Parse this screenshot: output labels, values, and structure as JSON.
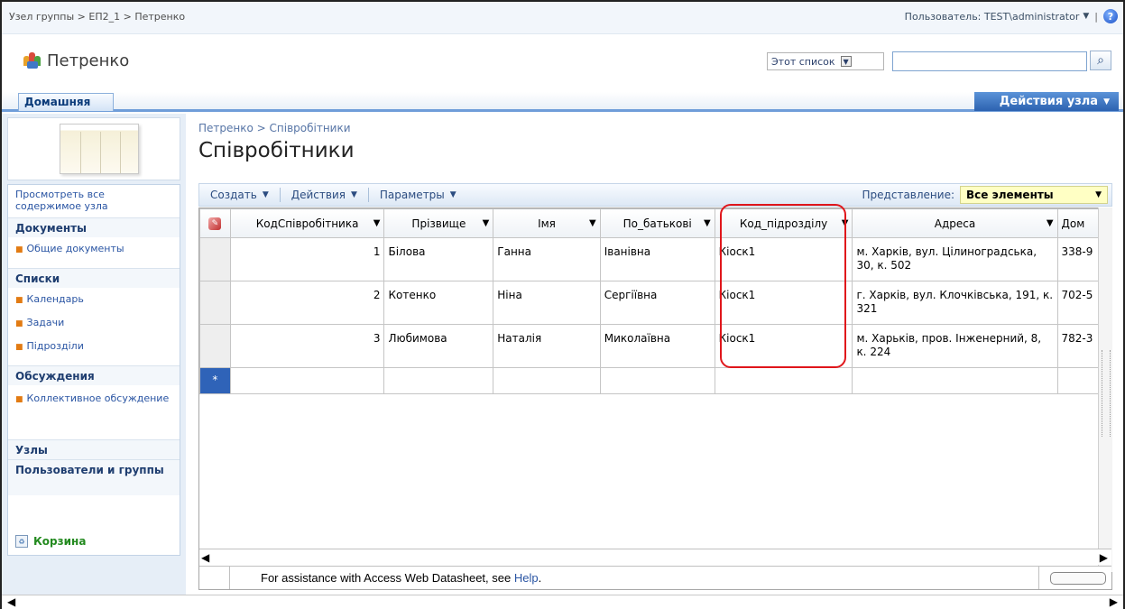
{
  "top": {
    "breadcrumb": "Узел группы > ЕП2_1 > Петренко",
    "user_label": "Пользователь: TEST\\administrator",
    "dropdown_glyph": "▼",
    "separator": "|",
    "help_glyph": "?"
  },
  "site": {
    "title": "Петренко",
    "scope": "Этот список",
    "search_value": "",
    "search_glyph": "⌕"
  },
  "nav": {
    "home_tab": "Домашняя",
    "site_actions": "Действия узла"
  },
  "quicklaunch": {
    "view_all": "Просмотреть все содержимое узла",
    "sections": [
      {
        "title": "Документы",
        "items": [
          "Общие документы"
        ]
      },
      {
        "title": "Списки",
        "items": [
          "Календарь",
          "Задачи",
          "Підрозділи"
        ]
      },
      {
        "title": "Обсуждения",
        "items": [
          "Коллективное обсуждение"
        ]
      },
      {
        "title": "Узлы",
        "items": []
      },
      {
        "title": "Пользователи и группы",
        "items": []
      }
    ],
    "recycle": "Корзина"
  },
  "main": {
    "breadcrumb": "Петренко > Співробітники",
    "title": "Співробітники",
    "toolbar": {
      "new": "Создать",
      "actions": "Действия",
      "settings": "Параметры",
      "view_label": "Представление:",
      "view_value": "Все элементы"
    }
  },
  "datasheet": {
    "columns": [
      "КодСпівробітника",
      "Прізвище",
      "Імя",
      "По_батькові",
      "Код_підрозділу",
      "Адреса",
      "Дом"
    ],
    "rows": [
      [
        "1",
        "Білова",
        "Ганна",
        "Іванівна",
        "Кіоск1",
        "м. Харків, вул. Цілиноградська, 30, к. 502",
        "338-9"
      ],
      [
        "2",
        "Котенко",
        "Ніна",
        "Сергіївна",
        "Кіоск1",
        "г. Харків, вул. Клочківська, 191, к. 321",
        "702-5"
      ],
      [
        "3",
        "Любимова",
        "Наталія",
        "Миколаївна",
        "Кіоск1",
        "м. Харьків, пров. Інженерний, 8, к. 224",
        "782-3"
      ]
    ],
    "new_row_marker": "*",
    "status_prefix": "For assistance with Access Web Datasheet, see ",
    "status_link": "Help",
    "status_suffix": "."
  },
  "colors": {
    "accent": "#2c62b0",
    "highlight": "#e0161b",
    "view_select_bg": "#ffffc4"
  }
}
